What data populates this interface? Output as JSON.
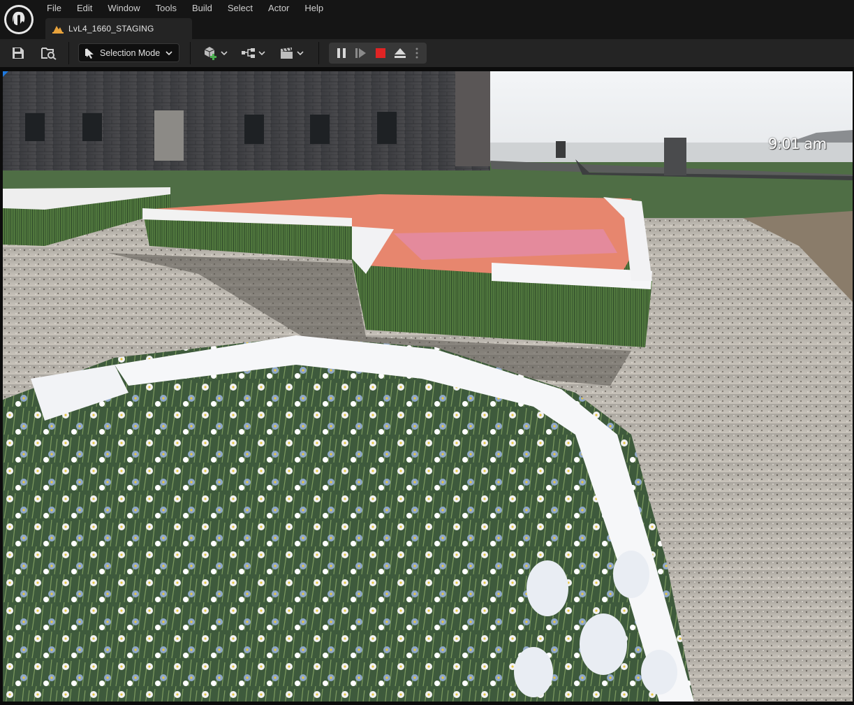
{
  "app": {
    "logo_icon": "unreal-engine-logo-icon",
    "menu": [
      "File",
      "Edit",
      "Window",
      "Tools",
      "Build",
      "Select",
      "Actor",
      "Help"
    ]
  },
  "tab": {
    "label": "LvL4_1660_STAGING",
    "icon": "level-icon",
    "icon_color": "#e8a33c"
  },
  "toolbar": {
    "save_icon": "save-icon",
    "browse_icon": "content-browser-icon",
    "mode_label": "Selection Mode",
    "add_icon": "add-actor-icon",
    "blueprint_icon": "blueprint-icon",
    "cinematics_icon": "cinematics-icon",
    "pause_icon": "pause-icon",
    "step_icon": "frame-advance-icon",
    "stop_icon": "stop-icon",
    "stop_color": "#e02424",
    "eject_icon": "eject-icon",
    "more_icon": "more-options-icon"
  },
  "viewport": {
    "time_text": "9:01 am"
  }
}
